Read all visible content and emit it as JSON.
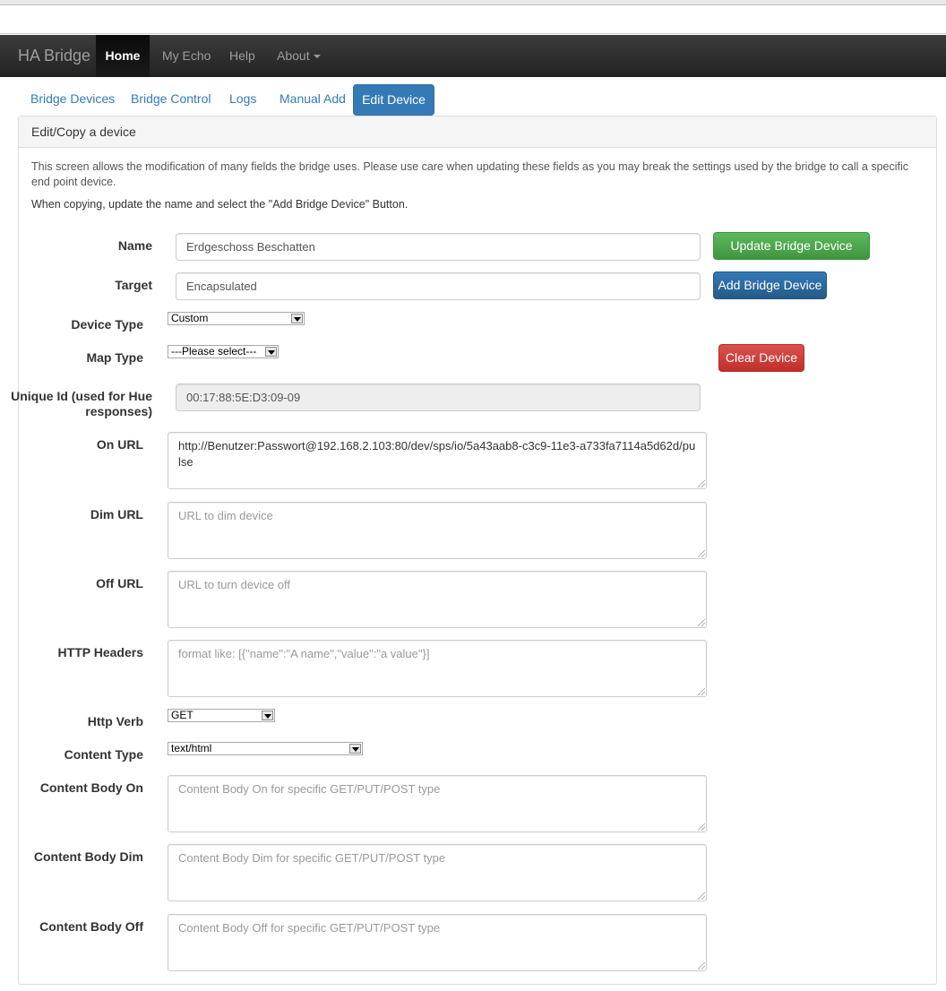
{
  "navbar": {
    "brand": "HA Bridge",
    "items": [
      {
        "label": "Home"
      },
      {
        "label": "My Echo"
      },
      {
        "label": "Help"
      },
      {
        "label": "About"
      }
    ]
  },
  "tabs": [
    {
      "label": "Bridge Devices"
    },
    {
      "label": "Bridge Control"
    },
    {
      "label": "Logs"
    },
    {
      "label": "Manual Add"
    },
    {
      "label": "Edit Device"
    }
  ],
  "panel": {
    "heading": "Edit/Copy a device",
    "description": "This screen allows the modification of many fields the bridge uses. Please use care when updating these fields as you may break the settings used by the bridge to call a specific end point device.",
    "copy_hint": "When copying, update the name and select the \"Add Bridge Device\" Button."
  },
  "form": {
    "name": {
      "label": "Name",
      "value": "Erdgeschoss Beschatten"
    },
    "target": {
      "label": "Target",
      "value": "Encapsulated"
    },
    "device_type": {
      "label": "Device Type",
      "value": "Custom"
    },
    "map_type": {
      "label": "Map Type",
      "value": "---Please select---"
    },
    "unique_id": {
      "label_line1": "Unique Id (used for Hue",
      "label_line2": "responses)",
      "value": "00:17:88:5E:D3:09-09"
    },
    "on_url": {
      "label": "On URL",
      "value": "http://Benutzer:Passwort@192.168.2.103:80/dev/sps/io/5a43aab8-c3c9-11e3-a733fa7114a5d62d/pulse"
    },
    "dim_url": {
      "label": "Dim URL",
      "placeholder": "URL to dim device"
    },
    "off_url": {
      "label": "Off URL",
      "placeholder": "URL to turn device off"
    },
    "http_headers": {
      "label": "HTTP Headers",
      "placeholder": "format like: [{\"name\":\"A name\",\"value\":\"a value\"}]"
    },
    "http_verb": {
      "label": "Http Verb",
      "value": "GET"
    },
    "content_type": {
      "label": "Content Type",
      "value": "text/html"
    },
    "content_body_on": {
      "label": "Content Body On",
      "placeholder": "Content Body On for specific GET/PUT/POST type"
    },
    "content_body_dim": {
      "label": "Content Body Dim",
      "placeholder": "Content Body Dim for specific GET/PUT/POST type"
    },
    "content_body_off": {
      "label": "Content Body Off",
      "placeholder": "Content Body Off for specific GET/PUT/POST type"
    }
  },
  "buttons": {
    "update": "Update Bridge Device",
    "add": "Add Bridge Device",
    "clear": "Clear Device"
  },
  "colors": {
    "navbar": "#222222",
    "link": "#337ab7",
    "success": "#5cb85c",
    "primary": "#337ab7",
    "danger": "#d9534f"
  }
}
